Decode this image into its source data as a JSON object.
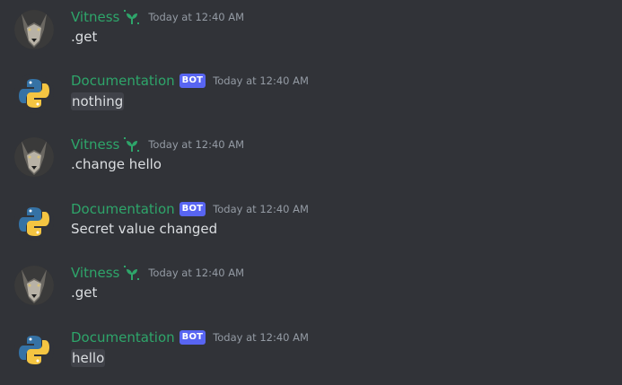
{
  "messages": [
    {
      "author": "Vitness",
      "author_type": "user",
      "badge": "",
      "timestamp": "Today at 12:40 AM",
      "text": ".get",
      "code": false
    },
    {
      "author": "Documentation",
      "author_type": "bot",
      "badge": "BOT",
      "timestamp": "Today at 12:40 AM",
      "text": "nothing",
      "code": true
    },
    {
      "author": "Vitness",
      "author_type": "user",
      "badge": "",
      "timestamp": "Today at 12:40 AM",
      "text": ".change hello",
      "code": false
    },
    {
      "author": "Documentation",
      "author_type": "bot",
      "badge": "BOT",
      "timestamp": "Today at 12:40 AM",
      "text": "Secret value changed",
      "code": false
    },
    {
      "author": "Vitness",
      "author_type": "user",
      "badge": "",
      "timestamp": "Today at 12:40 AM",
      "text": ".get",
      "code": false
    },
    {
      "author": "Documentation",
      "author_type": "bot",
      "badge": "BOT",
      "timestamp": "Today at 12:40 AM",
      "text": "hello",
      "code": true
    }
  ],
  "colors": {
    "background": "#313338",
    "username": "#2ea56a",
    "bot_badge": "#5865f2",
    "timestamp": "#949ba4",
    "text": "#dbdee1",
    "code_bg": "#404249"
  },
  "icons": {
    "user_avatar": "wolf-avatar-icon",
    "bot_avatar": "python-logo-icon",
    "user_badge": "sprout-icon"
  }
}
